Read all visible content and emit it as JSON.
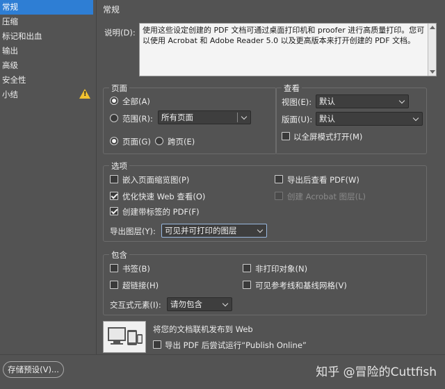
{
  "sidebar": {
    "items": [
      {
        "label": "常规",
        "active": true
      },
      {
        "label": "压缩"
      },
      {
        "label": "标记和出血"
      },
      {
        "label": "输出"
      },
      {
        "label": "高级"
      },
      {
        "label": "安全性"
      },
      {
        "label": "小结",
        "warning": true
      }
    ]
  },
  "main": {
    "title": "常规",
    "description": {
      "label": "说明(D):",
      "text": "使用这些设定创建的 PDF 文档可通过桌面打印机和 proofer 进行高质量打印。您可以使用 Acrobat 和 Adobe Reader 5.0 以及更高版本来打开创建的 PDF 文档。"
    },
    "pages": {
      "title": "页面",
      "all": "全部(A)",
      "range": "范围(R):",
      "range_value": "所有页面",
      "pages_opt": "页面(G)",
      "spreads_opt": "跨页(E)"
    },
    "view": {
      "title": "查看",
      "view_label": "视图(E):",
      "view_value": "默认",
      "layout_label": "版面(U):",
      "layout_value": "默认",
      "fullscreen": "以全屏模式打开(M)"
    },
    "options": {
      "title": "选项",
      "embed_thumbs": "嵌入页面缩览图(P)",
      "view_after": "导出后查看 PDF(W)",
      "optimize_web": "优化快速 Web 查看(O)",
      "acrobat_layers": "创建 Acrobat 图层(L)",
      "tagged_pdf": "创建带标签的 PDF(F)",
      "export_layers_label": "导出图层(Y):",
      "export_layers_value": "可见并可打印的图层"
    },
    "include": {
      "title": "包含",
      "bookmarks": "书签(B)",
      "nonprinting": "非打印对象(N)",
      "hyperlinks": "超链接(H)",
      "guides": "可见参考线和基线网格(V)",
      "interactive_label": "交互式元素(I):",
      "interactive_value": "请勿包含"
    },
    "publish": {
      "heading": "将您的文档联机发布到 Web",
      "checkbox": "导出 PDF 后尝试运行“Publish Online”"
    }
  },
  "bottom": {
    "save_preset": "存储预设(V)...",
    "watermark": "知乎 @冒险的Cuttfish"
  },
  "colors": {
    "background": "#535353",
    "active": "#2e7ed4",
    "warning": "#f2c230"
  }
}
